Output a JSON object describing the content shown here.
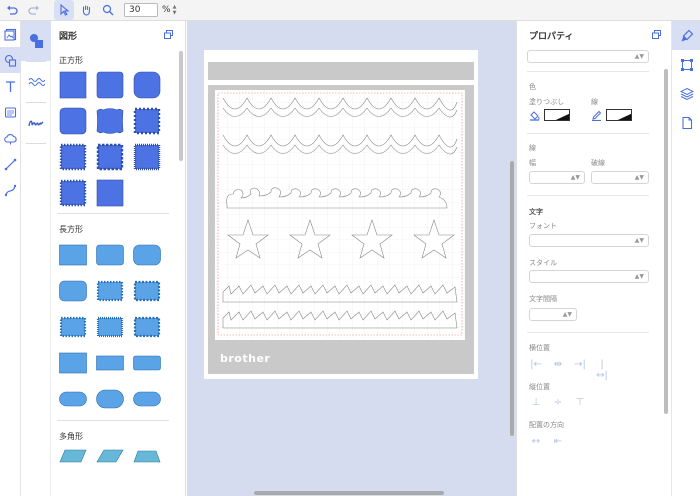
{
  "toolbar": {
    "zoom_value": "30",
    "zoom_unit": "%"
  },
  "shapes_panel": {
    "title": "図形",
    "sections": {
      "square": "正方形",
      "rectangle": "長方形",
      "polygon": "多角形"
    }
  },
  "canvas": {
    "mat_brand": "brother"
  },
  "properties": {
    "title": "プロパティ",
    "color_label": "色",
    "fill_label": "塗りつぶし",
    "line_label": "線",
    "line_section": "線",
    "width_label": "幅",
    "dash_label": "破線",
    "text_label": "文字",
    "font_label": "フォント",
    "style_label": "スタイル",
    "spacing_label": "文字間隔",
    "h_position_label": "横位置",
    "v_position_label": "縦位置",
    "direction_label": "配置の方向"
  },
  "colors": {
    "accent": "#4a6fe0",
    "shape_blue": "#4d72e3",
    "rect_blue": "#5aa3e6",
    "poly_blue": "#67b8d8",
    "canvas_bg": "#d6dcf0"
  }
}
